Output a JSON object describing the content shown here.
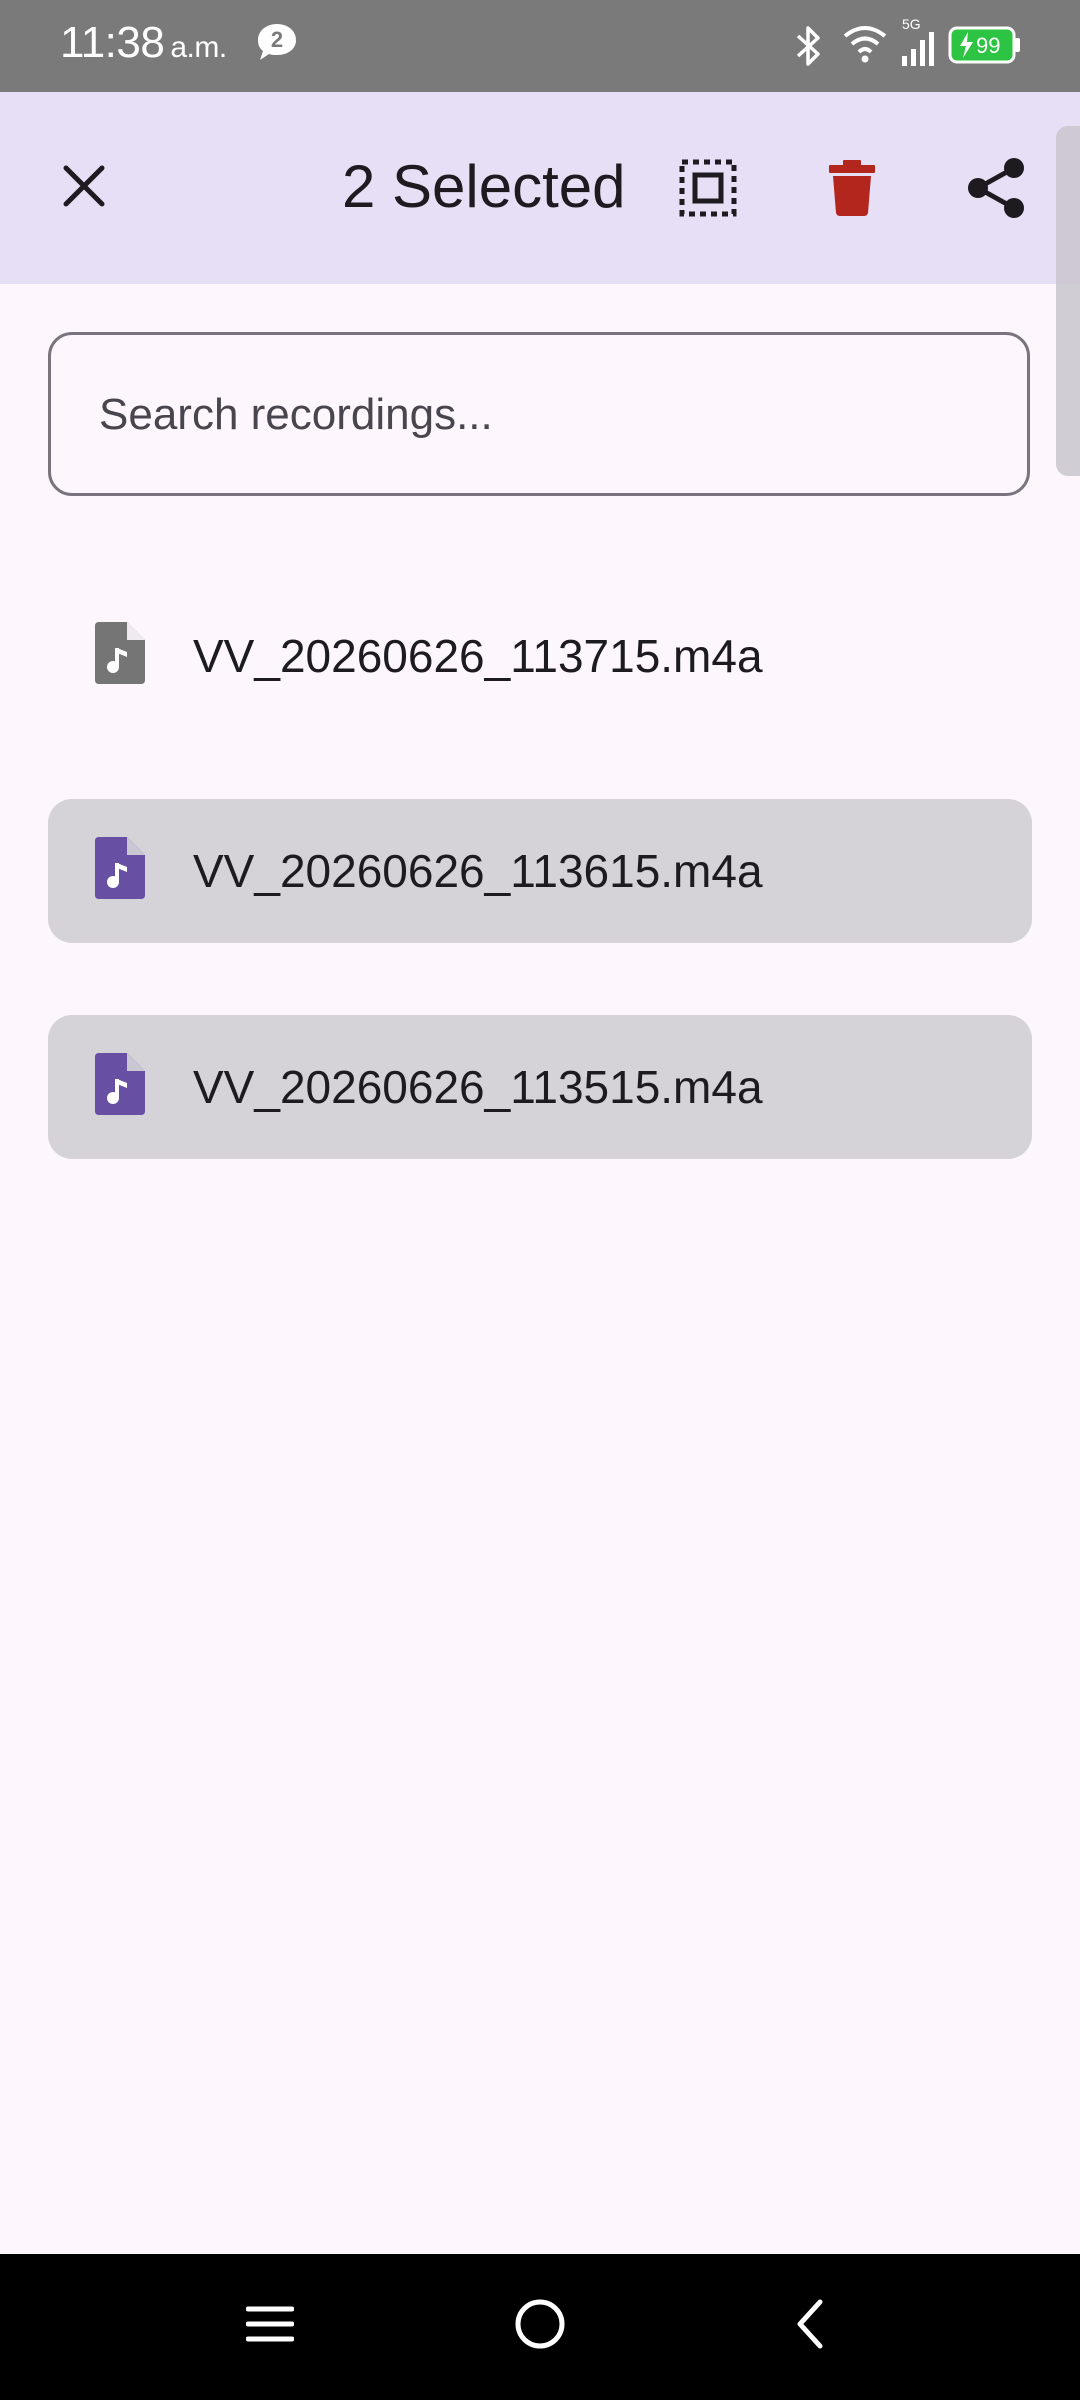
{
  "status_bar": {
    "time": "11:38",
    "ampm": "a.m.",
    "notification_count": "2",
    "network_label": "5G",
    "battery": "99"
  },
  "app_bar": {
    "title": "2 Selected",
    "icons": [
      "close-icon",
      "select-all-icon",
      "delete-icon",
      "share-icon"
    ],
    "delete_color": "#b3261e"
  },
  "search": {
    "placeholder": "Search recordings...",
    "value": ""
  },
  "recordings": [
    {
      "name": "VV_20260626_113715.m4a",
      "selected": false
    },
    {
      "name": "VV_20260626_113615.m4a",
      "selected": true
    },
    {
      "name": "VV_20260626_113515.m4a",
      "selected": true
    }
  ],
  "colors": {
    "accent": "#6750a4",
    "unselected_icon": "#757575",
    "selected_row": "#d6d3d8",
    "app_bar": "#e6dff5",
    "background": "#fdf7fd"
  },
  "nav_bar": {
    "icons": [
      "menu-icon",
      "home-icon",
      "back-icon"
    ]
  }
}
